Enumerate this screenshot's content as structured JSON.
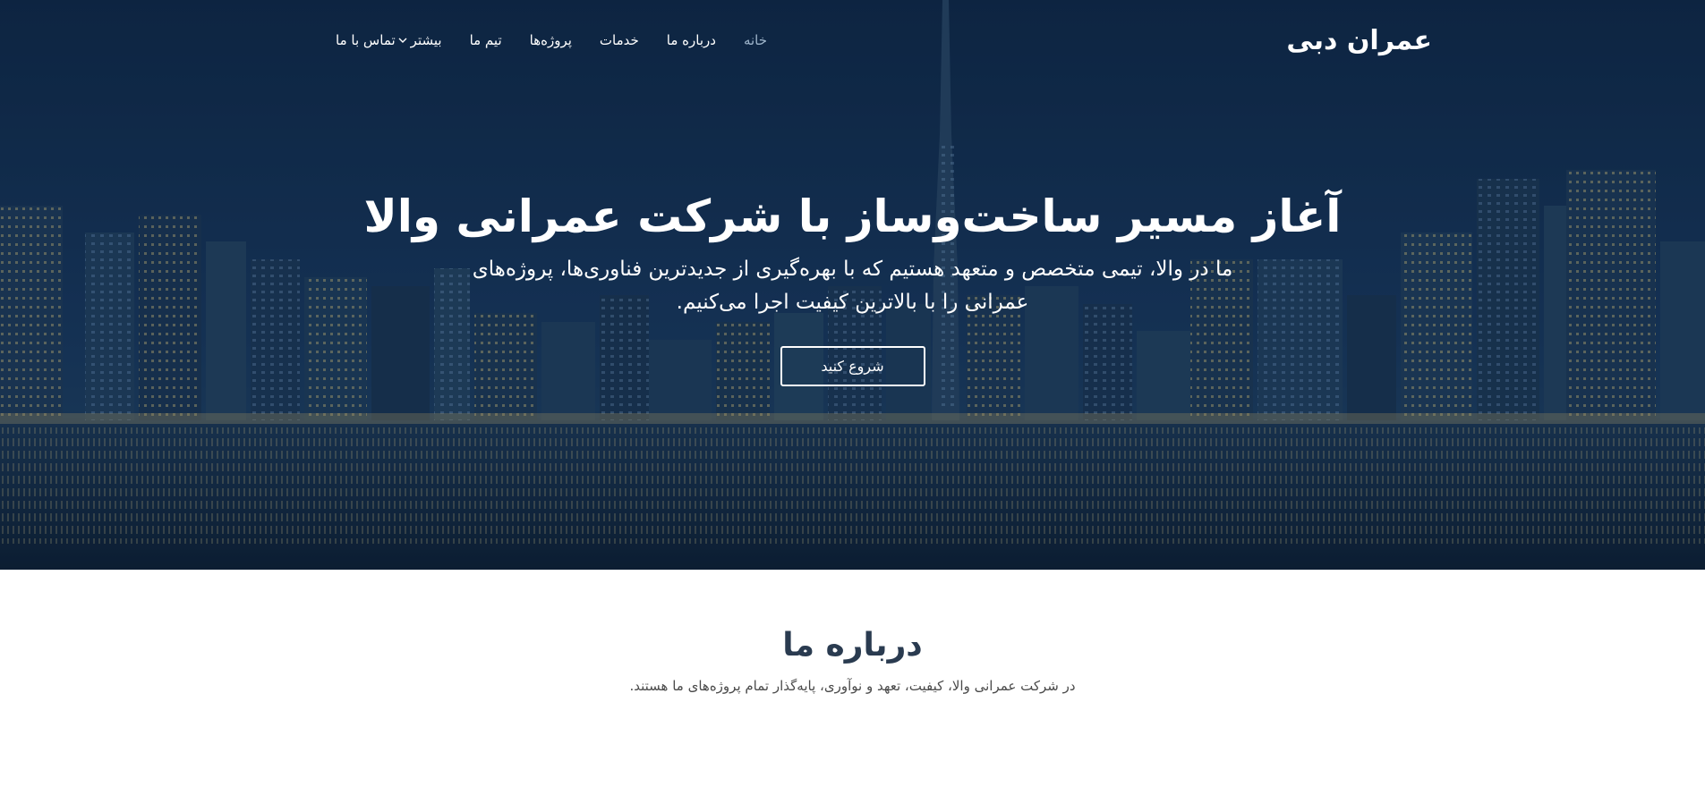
{
  "header": {
    "logo": "عمران دبی",
    "nav": [
      {
        "label": "خانه",
        "active": true
      },
      {
        "label": "درباره ما"
      },
      {
        "label": "خدمات"
      },
      {
        "label": "پروژه‌ها"
      },
      {
        "label": "تیم ما"
      },
      {
        "label": "بیشتر",
        "icon": "chevron-down-icon"
      },
      {
        "label": "تماس با ما"
      }
    ]
  },
  "hero": {
    "title": "آغاز مسیر ساخت‌وساز با شرکت عمرانی والا",
    "subtitle": "ما در والا، تیمی متخصص و متعهد هستیم که با بهره‌گیری از جدیدترین فناوری‌ها، پروژه‌های عمرانی را با بالاترین کیفیت اجرا می‌کنیم.",
    "cta_label": "شروع کنید"
  },
  "about": {
    "title": "درباره ما",
    "text": "در شرکت عمرانی والا، کیفیت، تعهد و نوآوری، پایه‌گذار تمام پروژه‌های ما هستند."
  },
  "colors": {
    "hero_overlay": "#13304f",
    "nav_active": "#9fb6cc",
    "about_title": "#2a3b50"
  }
}
